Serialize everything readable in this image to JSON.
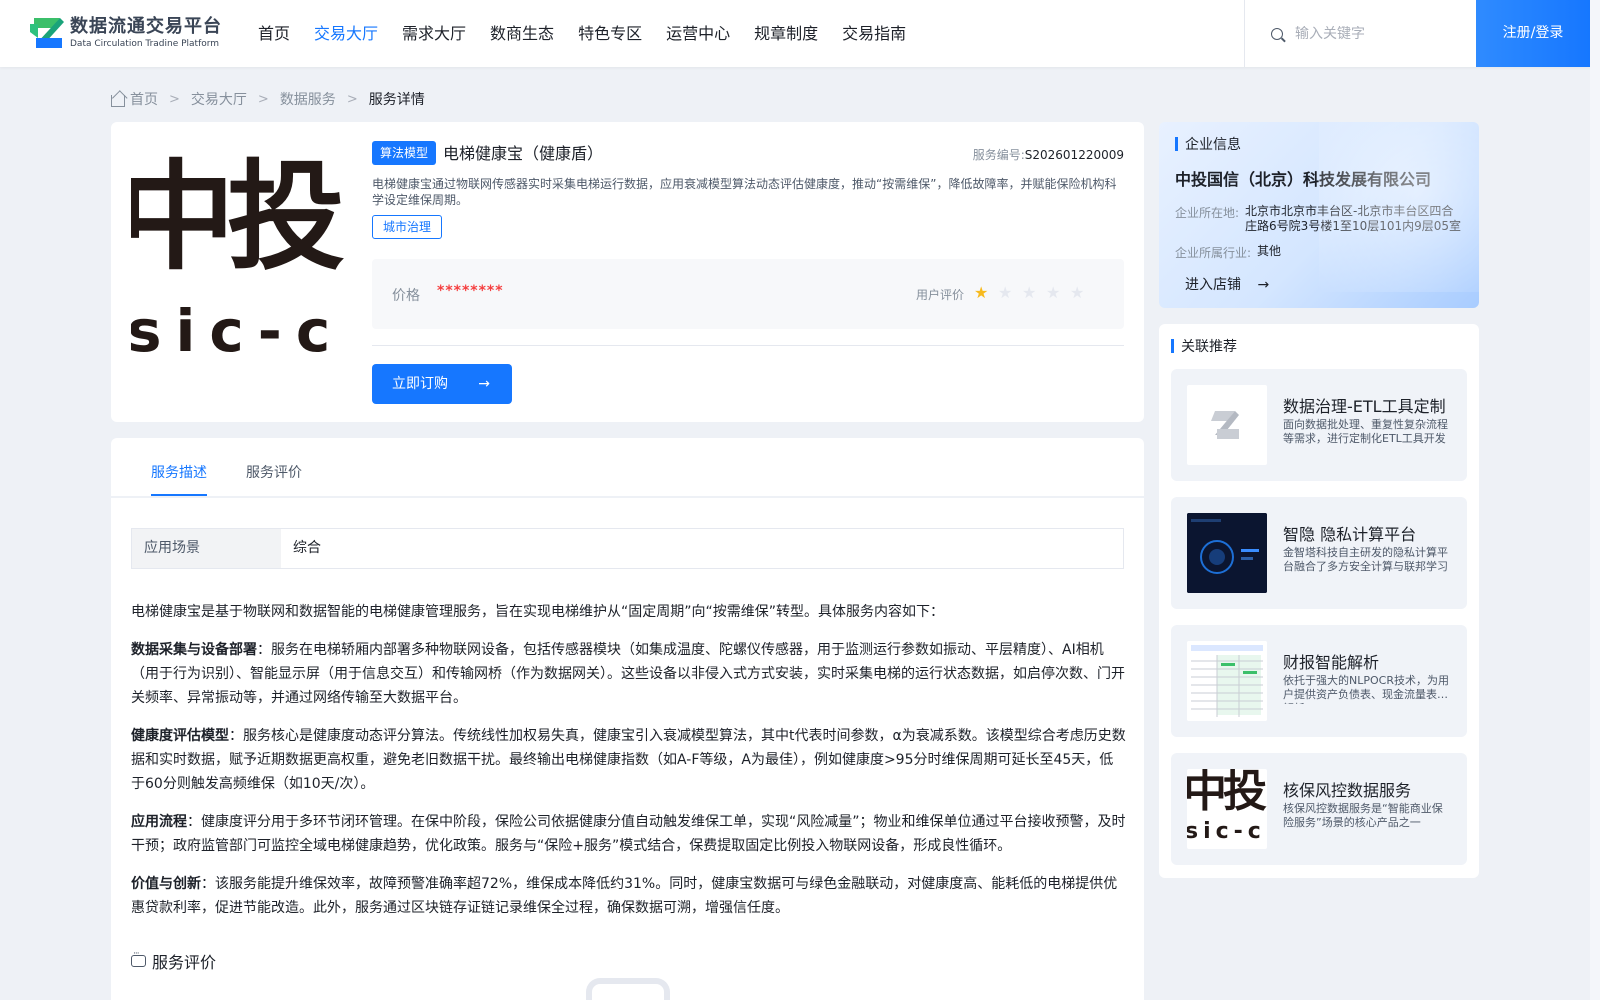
{
  "header": {
    "logo_title": "数据流通交易平台",
    "logo_sub": "Data Circulation Tradine Platform",
    "nav": [
      "首页",
      "交易大厅",
      "需求大厅",
      "数商生态",
      "特色专区",
      "运营中心",
      "规章制度",
      "交易指南"
    ],
    "active_nav": "交易大厅",
    "search_placeholder": "输入关键字",
    "login_label": "注册/登录"
  },
  "breadcrumb": [
    "首页",
    "交易大厅",
    "数据服务",
    "服务详情"
  ],
  "product": {
    "image_text_big": "中投",
    "image_text_small": "sic-c",
    "type_tag": "算法模型",
    "title": "电梯健康宝（健康盾）",
    "serial_label": "服务编号:",
    "serial_value": "S202601220009",
    "description": "电梯健康宝通过物联网传感器实时采集电梯运行数据，应用衰减模型算法动态评估健康度，推动“按需维保”，降低故障率，并赋能保险机构科学设定维保周期。",
    "scene_tag": "城市治理",
    "price_label": "价格",
    "price_value": "********",
    "rating_label": "用户评价",
    "rating": 1,
    "rating_max": 5,
    "buy_label": "立即订购"
  },
  "company": {
    "section_title": "企业信息",
    "name": "中投国信（北京）科技发展有限公司",
    "location_label": "企业所在地:",
    "location_value": "北京市北京市丰台区-北京市丰台区四合庄路6号院3号楼1至10层101内9层05室",
    "industry_label": "企业所属行业:",
    "industry_value": "其他",
    "enter_shop": "进入店铺"
  },
  "recommend": {
    "section_title": "关联推荐",
    "items": [
      {
        "title": "数据治理-ETL工具定制",
        "desc": "面向数据批处理、重复性复杂流程等需求，进行定制化ETL工具开发"
      },
      {
        "title": "智隐 隐私计算平台",
        "desc": "金智塔科技自主研发的隐私计算平台融合了多方安全计算与联邦学习"
      },
      {
        "title": "财报智能解析",
        "desc": "依托于强大的NLPOCR技术，为用户提供资产负债表、现金流量表等解析"
      },
      {
        "title": "核保风控数据服务",
        "desc": "核保风控数据服务是“智能商业保险服务”场景的核心产品之一"
      }
    ]
  },
  "tabs": [
    "服务描述",
    "服务评价"
  ],
  "scene": {
    "label": "应用场景",
    "value": "综合"
  },
  "detail": {
    "intro": "电梯健康宝是基于物联网和数据智能的电梯健康管理服务，旨在实现电梯维护从“固定周期”向“按需维保”转型。具体服务内容如下：",
    "p1_title": "数据采集与设备部署",
    "p1_body": "：服务在电梯轿厢内部署多种物联网设备，包括传感器模块（如集成温度、陀螺仪传感器，用于监测运行参数如振动、平层精度）、AI相机（用于行为识别）、智能显示屏（用于信息交互）和传输网桥（作为数据网关）。这些设备以非侵入式方式安装，实时采集电梯的运行状态数据，如启停次数、门开关频率、异常振动等，并通过网络传输至大数据平台。",
    "p2_title": "健康度评估模型",
    "p2_body": "：服务核心是健康度动态评分算法。传统线性加权易失真，健康宝引入衰减模型算法，其中t代表时间参数，α为衰减系数。该模型综合考虑历史数据和实时数据，赋予近期数据更高权重，避免老旧数据干扰。最终输出电梯健康指数（如A-F等级，A为最佳），例如健康度>95分时维保周期可延长至45天，低于60分则触发高频维保（如10天/次）。",
    "p3_title": "应用流程",
    "p3_body": "：健康度评分用于多环节闭环管理。在保中阶段，保险公司依据健康分值自动触发维保工单，实现“风险减量”；物业和维保单位通过平台接收预警，及时干预；政府监管部门可监控全域电梯健康趋势，优化政策。服务与“保险+服务”模式结合，保费提取固定比例投入物联网设备，形成良性循环。",
    "p4_title": "价值与创新",
    "p4_body": "：该服务能提升维保效率，故障预警准确率超72%，维保成本降低约31%。同时，健康宝数据可与绿色金融联动，对健康度高、能耗低的电梯提供优惠贷款利率，促进节能改造。此外，服务通过区块链存证链记录维保全过程，确保数据可溯，增强信任度。"
  },
  "review_title": "服务评价",
  "colors": {
    "primary": "#1677ff",
    "price": "#f53f3f",
    "star": "#f7ba1e",
    "background": "#eef1f6"
  }
}
